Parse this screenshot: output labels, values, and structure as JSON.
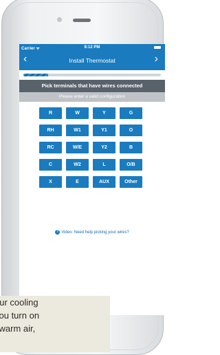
{
  "status": {
    "carrier": "Carrier ᯤ",
    "time": "8:12 PM"
  },
  "nav": {
    "title": "Install Thermostat",
    "back_icon": "chevron-left-icon",
    "forward_icon": "chevron-right-icon"
  },
  "progress": {
    "fraction": 0.18
  },
  "heading": "Pick terminals that have wires connected",
  "error": "Please enter a valid configuration",
  "terminals": [
    "R",
    "W",
    "Y",
    "G",
    "RH",
    "W1",
    "Y1",
    "O",
    "RC",
    "W/E",
    "Y2",
    "B",
    "C",
    "W2",
    "L",
    "O/B",
    "X",
    "E",
    "AUX",
    "Other"
  ],
  "help": {
    "icon": "question-icon",
    "icon_glyph": "?",
    "text": "Video: Need help picking your wires?"
  },
  "caption": [
    "our cooling",
    "you turn on",
    "l warm air,"
  ],
  "colors": {
    "accent": "#1a7bbf",
    "heading_bg": "#58626b",
    "error_bg": "#bfc3c7"
  }
}
